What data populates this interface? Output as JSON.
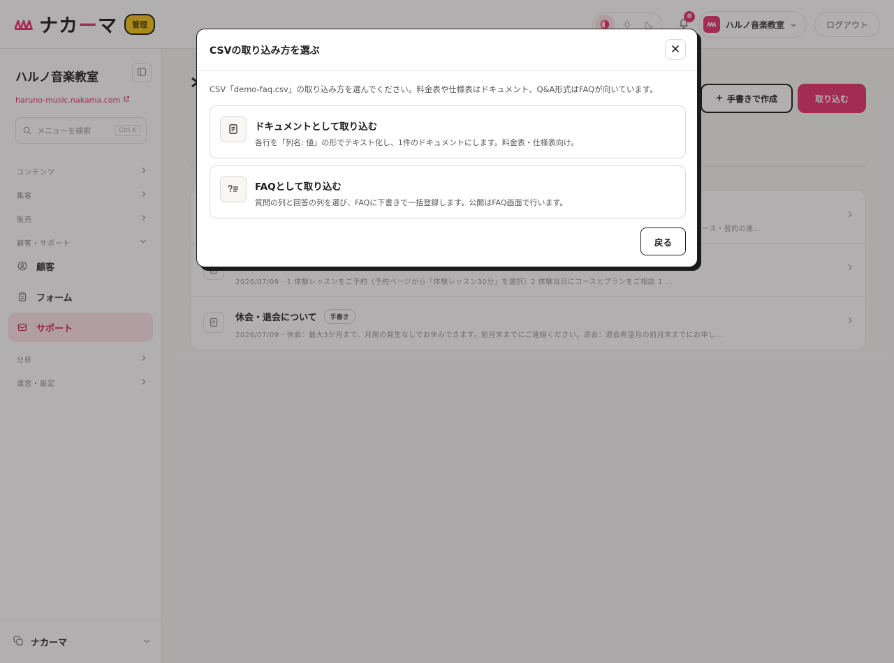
{
  "header": {
    "brand_prefix": "ナカ",
    "brand_accent": "ー",
    "brand_suffix": "マ",
    "brand_badge": "管理",
    "notification_count": "0",
    "account_name": "ハルノ音楽教室",
    "logout_label": "ログアウト"
  },
  "sidebar": {
    "org_name": "ハルノ音楽教室",
    "org_url": "haruno-music.nakama.com",
    "search_placeholder": "メニューを検索",
    "search_shortcut": "Ctrl K",
    "groups": {
      "contents": "コンテンツ",
      "sales": "集客",
      "selling": "販売",
      "customer_support": "顧客・サポート",
      "analytics": "分析",
      "operations": "運営・設定"
    },
    "items": {
      "customers": "顧客",
      "forms": "フォーム",
      "support": "サポート"
    },
    "footer_name": "ナカーマ"
  },
  "main": {
    "manual_create_label": "手書きで作成",
    "import_label": "取り込む",
    "documents": [
      {
        "title": "",
        "badge": "",
        "meta": "… ース・習的の進…"
      },
      {
        "title": "",
        "badge": "",
        "meta": "2026/07/09 · 1 体験レッスンをご予約（予約ページから「体験レッスン30分」を選択）2 体験当日にコースとプランをご相談 1 …"
      },
      {
        "title": "休会・退会について",
        "badge": "手書き",
        "meta": "2026/07/09 · 休会：最大3か月まで、月謝の発生なしでお休みできます。前月末までにご連絡ください。退会：退会希望月の前月末までにお申し…"
      }
    ]
  },
  "modal": {
    "title": "CSVの取り込み方を選ぶ",
    "description": "CSV「demo-faq.csv」の取り込み方を選んでください。料金表や仕様表はドキュメント、Q&A形式はFAQが向いています。",
    "options": [
      {
        "title": "ドキュメントとして取り込む",
        "description": "各行を「列名: 値」の形でテキスト化し、1件のドキュメントにします。料金表・仕様表向け。",
        "icon": "document-icon"
      },
      {
        "title": "FAQとして取り込む",
        "description": "質問の列と回答の列を選び、FAQに下書きで一括登録します。公開はFAQ画面で行います。",
        "icon": "faq-icon"
      }
    ],
    "back_label": "戻る"
  },
  "colors": {
    "accent": "#e8336f",
    "badge_yellow": "#f5c518",
    "overlay": "rgba(40,34,34,0.36)"
  }
}
